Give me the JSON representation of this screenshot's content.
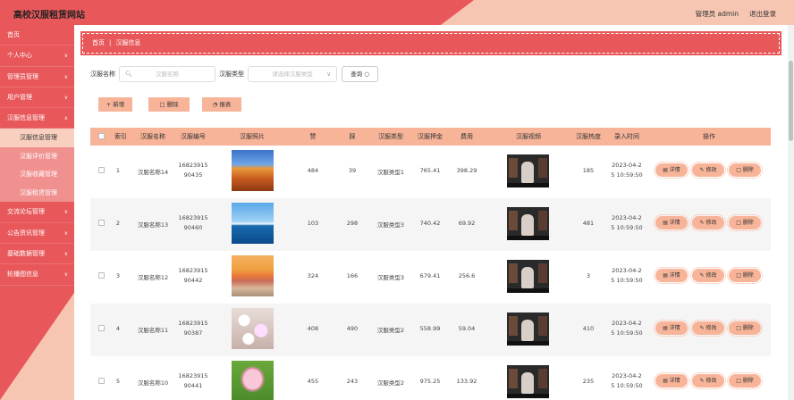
{
  "header": {
    "title": "高校汉服租赁网站",
    "user_label": "管理员 admin",
    "logout_label": "退出登录"
  },
  "sidebar": {
    "items": [
      {
        "label": "首页",
        "chevron": false
      },
      {
        "label": "个人中心",
        "chevron": true
      },
      {
        "label": "管理员管理",
        "chevron": true
      },
      {
        "label": "用户管理",
        "chevron": true
      },
      {
        "label": "汉服信息管理",
        "chevron": true,
        "expanded": true
      }
    ],
    "subitems": [
      {
        "label": "汉服信息管理",
        "active": true
      },
      {
        "label": "汉服评价管理",
        "active": false
      },
      {
        "label": "汉服收藏管理",
        "active": false
      },
      {
        "label": "汉服租赁管理",
        "active": false
      }
    ],
    "items_after": [
      {
        "label": "交流论坛管理",
        "chevron": true
      },
      {
        "label": "公告资讯管理",
        "chevron": true
      },
      {
        "label": "基础数据管理",
        "chevron": true
      },
      {
        "label": "轮播图信息",
        "chevron": true
      }
    ]
  },
  "breadcrumb": {
    "home": "首页",
    "separator": "|",
    "current": "汉服信息"
  },
  "search": {
    "name_label": "汉服名称",
    "name_placeholder": "汉服名称",
    "type_label": "汉服类型",
    "type_placeholder": "请选择汉服类型",
    "button_label": "查询"
  },
  "actions": {
    "add": "新增",
    "delete": "删除",
    "report": "报表"
  },
  "table": {
    "columns": [
      "索引",
      "汉服名称",
      "汉服编号",
      "汉服照片",
      "赞",
      "踩",
      "汉服类型",
      "汉服押金",
      "费用",
      "汉服视频",
      "汉服热度",
      "录入时间",
      "操作"
    ],
    "rows": [
      {
        "index": "1",
        "name": "汉服名称14",
        "code1": "16823915",
        "code2": "90435",
        "photo": "autumn-mountain",
        "likes": "484",
        "dislikes": "39",
        "type": "汉服类型1",
        "deposit": "765.41",
        "fee": "398.29",
        "heat": "185",
        "time1": "2023-04-2",
        "time2": "5 10:59:50"
      },
      {
        "index": "2",
        "name": "汉服名称13",
        "code1": "16823915",
        "code2": "90460",
        "photo": "sea-sky",
        "likes": "103",
        "dislikes": "298",
        "type": "汉服类型3",
        "deposit": "740.42",
        "fee": "69.92",
        "heat": "481",
        "time1": "2023-04-2",
        "time2": "5 10:59:50"
      },
      {
        "index": "3",
        "name": "汉服名称12",
        "code1": "16823915",
        "code2": "90442",
        "photo": "sunset-beach",
        "likes": "324",
        "dislikes": "166",
        "type": "汉服类型3",
        "deposit": "679.41",
        "fee": "256.6",
        "heat": "3",
        "time1": "2023-04-2",
        "time2": "5 10:59:50"
      },
      {
        "index": "4",
        "name": "汉服名称11",
        "code1": "16823915",
        "code2": "90387",
        "photo": "blossom-branch",
        "likes": "408",
        "dislikes": "490",
        "type": "汉服类型2",
        "deposit": "558.99",
        "fee": "59.04",
        "heat": "410",
        "time1": "2023-04-2",
        "time2": "5 10:59:50"
      },
      {
        "index": "5",
        "name": "汉服名称10",
        "code1": "16823915",
        "code2": "90441",
        "photo": "lotus-flower",
        "likes": "455",
        "dislikes": "243",
        "type": "汉服类型2",
        "deposit": "975.25",
        "fee": "133.92",
        "heat": "235",
        "time1": "2023-04-2",
        "time2": "5 10:59:50"
      }
    ],
    "op_labels": {
      "detail": "详情",
      "edit": "修改",
      "delete": "删除"
    }
  },
  "colors": {
    "primary": "#e8575a",
    "accent": "#f7b499",
    "light": "#f7c6b2"
  }
}
